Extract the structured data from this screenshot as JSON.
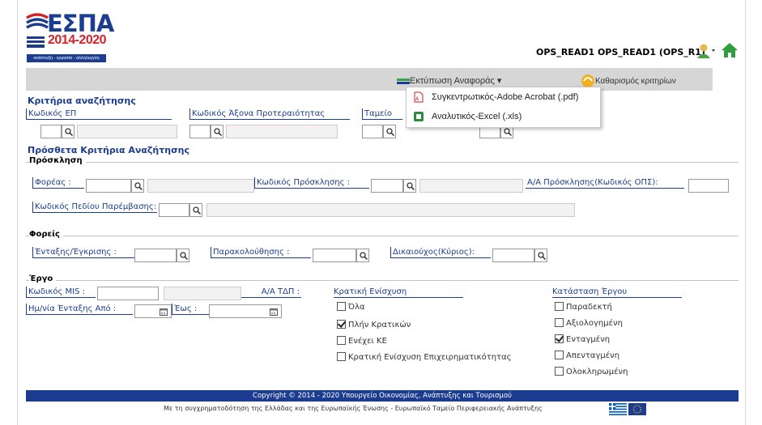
{
  "header": {
    "logo_text": "ΕΣΠΑ",
    "logo_years": "2014-2020",
    "logo_slogan": "ανάπτυξη - εργασία - αλληλεγγύη",
    "user": "OPS_READ1 OPS_READ1 (OPS_R1)"
  },
  "toolbar": {
    "print_label": "Εκτύπωση Αναφοράς",
    "clear_label": "Καθαρισμός κριτηρίων"
  },
  "print_menu": {
    "items": [
      {
        "label": "Συγκεντρωτικός-Adobe Acrobat (.pdf)",
        "icon": "pdf-icon"
      },
      {
        "label": "Αναλυτικός-Excel (.xls)",
        "icon": "excel-icon"
      }
    ]
  },
  "criteria": {
    "title": "Κριτήρια αναζήτησης",
    "ep_label": "Κωδικός ΕΠ",
    "axis_label": "Κωδικός Άξονα Προτεραιότητας",
    "fund_label": "Ταμείο"
  },
  "additional": {
    "title": "Πρόσθετα Κριτήρια Αναζήτησης"
  },
  "invitation": {
    "title": "Πρόσκληση",
    "body_label": "Φορέας :",
    "invitation_code_label": "Κωδικός Πρόσκλησης :",
    "aa_label": "Α/Α Πρόσκλησης(Κωδικός ΟΠΣ):",
    "intervention_label": "Κωδικός Πεδίου Παρέμβασης:"
  },
  "bodies": {
    "title": "Φορείς",
    "approval_label": "Ένταξης/Έγκρισης :",
    "monitoring_label": "Παρακολούθησης :",
    "beneficiary_label": "Δικαιούχος(Κύριος):"
  },
  "project": {
    "title": "Έργο",
    "mis_label": "Κωδικός MIS :",
    "tdp_label": "Α/Α ΤΔΠ :",
    "date_from_label": "Ημ/νία Ένταξης Από :",
    "date_to_label": "Έως :",
    "state_aid_title": "Κρατική Ενίσχυση",
    "state_aid_options": [
      {
        "label": "Όλα",
        "checked": false
      },
      {
        "label": "Πλήν Κρατικών",
        "checked": true
      },
      {
        "label": "Ενέχει ΚΕ",
        "checked": false
      },
      {
        "label": "Κρατική Ενίσχυση Επιχειρηματικότητας",
        "checked": false
      }
    ],
    "status_title": "Κατάσταση Έργου",
    "status_options": [
      {
        "label": "Παραδεκτή",
        "checked": false
      },
      {
        "label": "Αξιολογημένη",
        "checked": false
      },
      {
        "label": "Ενταγμένη",
        "checked": true
      },
      {
        "label": "Απενταγμένη",
        "checked": false
      },
      {
        "label": "Ολοκληρωμένη",
        "checked": false
      }
    ]
  },
  "footer": {
    "copyright": "Copyright © 2014 - 2020 Υπουργείο Οικονομίας, Ανάπτυξης και Τουρισμού",
    "cofinancing": "Με τη συγχρηματοδότηση της Ελλάδας και της Ευρωπαϊκής Ένωσης - Ευρωπαϊκό Ταμείο Περιφερειακής Ανάπτυξης"
  },
  "colors": {
    "accent": "#1c3d8f",
    "toolbar": "#d6d6d6",
    "logo_red": "#d2232a"
  }
}
